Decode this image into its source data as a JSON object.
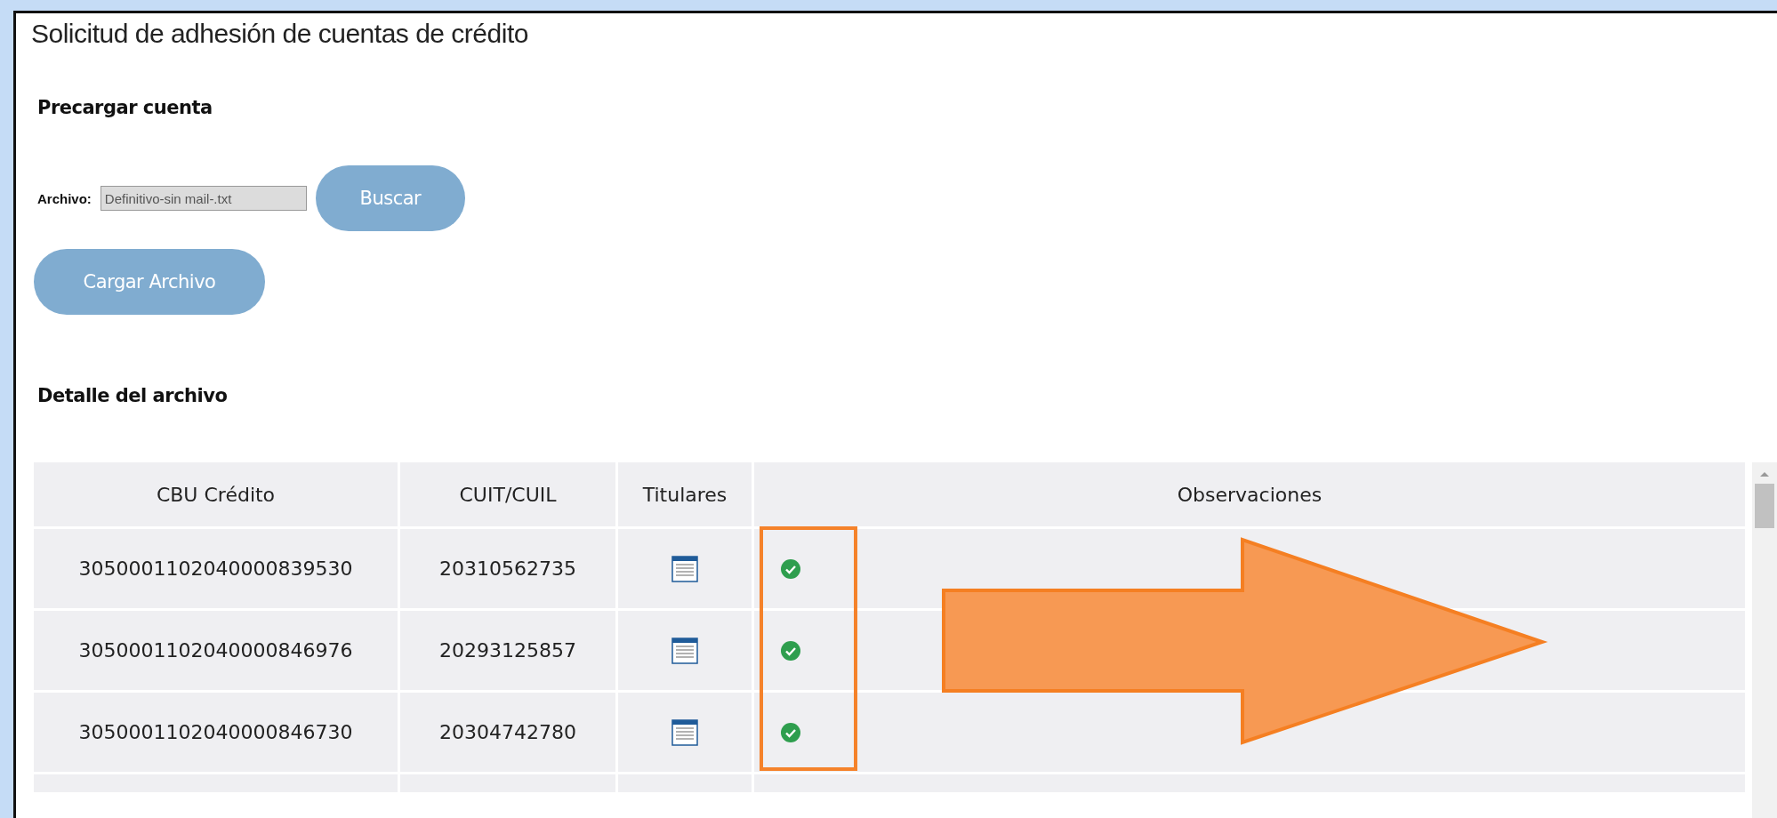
{
  "page": {
    "title": "Solicitud de adhesión de cuentas de crédito"
  },
  "preload": {
    "heading": "Precargar cuenta",
    "file_label": "Archivo:",
    "file_value": "Definitivo-sin mail-.txt",
    "browse_button": "Buscar",
    "load_button": "Cargar Archivo"
  },
  "detail": {
    "heading": "Detalle del archivo",
    "columns": [
      "CBU Crédito",
      "CUIT/CUIL",
      "Titulares",
      "Observaciones"
    ],
    "rows": [
      {
        "cbu": "3050001102040000839530",
        "cuit": "20310562735",
        "ok": true
      },
      {
        "cbu": "3050001102040000846976",
        "cuit": "20293125857",
        "ok": true
      },
      {
        "cbu": "3050001102040000846730",
        "cuit": "20304742780",
        "ok": true
      }
    ]
  }
}
